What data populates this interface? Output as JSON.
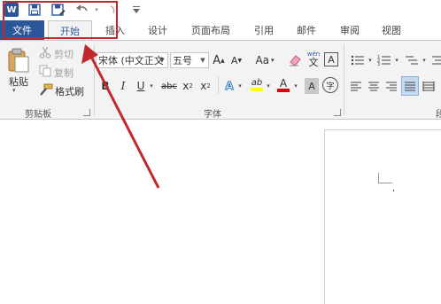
{
  "quick_access": {
    "icons": [
      "word-logo-icon",
      "save-icon",
      "save-as-icon",
      "undo-icon",
      "redo-icon",
      "customize-icon"
    ],
    "logo_letter": "W"
  },
  "tabs": [
    {
      "label": "文件"
    },
    {
      "label": "开始"
    },
    {
      "label": "插入"
    },
    {
      "label": "设计"
    },
    {
      "label": "页面布局"
    },
    {
      "label": "引用"
    },
    {
      "label": "邮件"
    },
    {
      "label": "审阅"
    },
    {
      "label": "视图"
    }
  ],
  "clipboard": {
    "paste": "粘贴",
    "cut": "剪切",
    "copy": "复制",
    "format_painter": "格式刷",
    "group_label": "剪贴板"
  },
  "font": {
    "font_name": "宋体 (中文正文",
    "font_size": "五号",
    "grow": "A",
    "shrink": "A",
    "case": "Aa",
    "phonetic_top": "wén",
    "phonetic_bottom": "文",
    "char_border": "A",
    "bold": "B",
    "italic": "I",
    "underline": "U",
    "strike": "abc",
    "subscript": "x",
    "superscript": "x",
    "text_effect": "A",
    "highlight": "ab",
    "font_color": "A",
    "char_shading": "A",
    "enclose": "字",
    "group_label": "字体"
  },
  "paragraph": {
    "group_label_partial": "段"
  },
  "colors": {
    "accent": "#2b579a",
    "annotation": "#c0282b",
    "highlight_yellow": "#ffff00",
    "font_red": "#e00000"
  }
}
